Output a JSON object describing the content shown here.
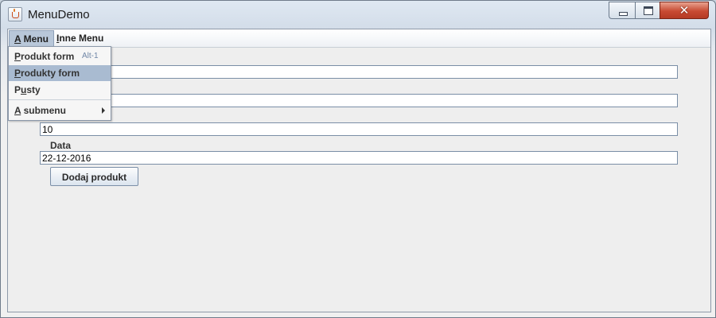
{
  "window": {
    "title": "MenuDemo"
  },
  "menubar": {
    "menus": [
      {
        "label_mnemonic": "A",
        "label_rest": " Menu"
      },
      {
        "label_mnemonic": "I",
        "label_rest": "nne Menu"
      }
    ]
  },
  "menu_popup": {
    "items": [
      {
        "mnemonic": "P",
        "rest": "rodukt form",
        "accelerator": "Alt-1"
      },
      {
        "mnemonic": "P",
        "rest": "rodukty form",
        "highlighted": true
      },
      {
        "pre": "P",
        "mnemonic": "u",
        "rest": "sty"
      },
      {
        "mnemonic": "A",
        "rest": " submenu",
        "has_submenu": true
      }
    ]
  },
  "form": {
    "fields": [
      {
        "value": ""
      },
      {
        "value": ""
      },
      {
        "value": "10"
      },
      {
        "label": "Data",
        "value": "22-12-2016"
      }
    ],
    "submit_label": "Dodaj produkt"
  }
}
